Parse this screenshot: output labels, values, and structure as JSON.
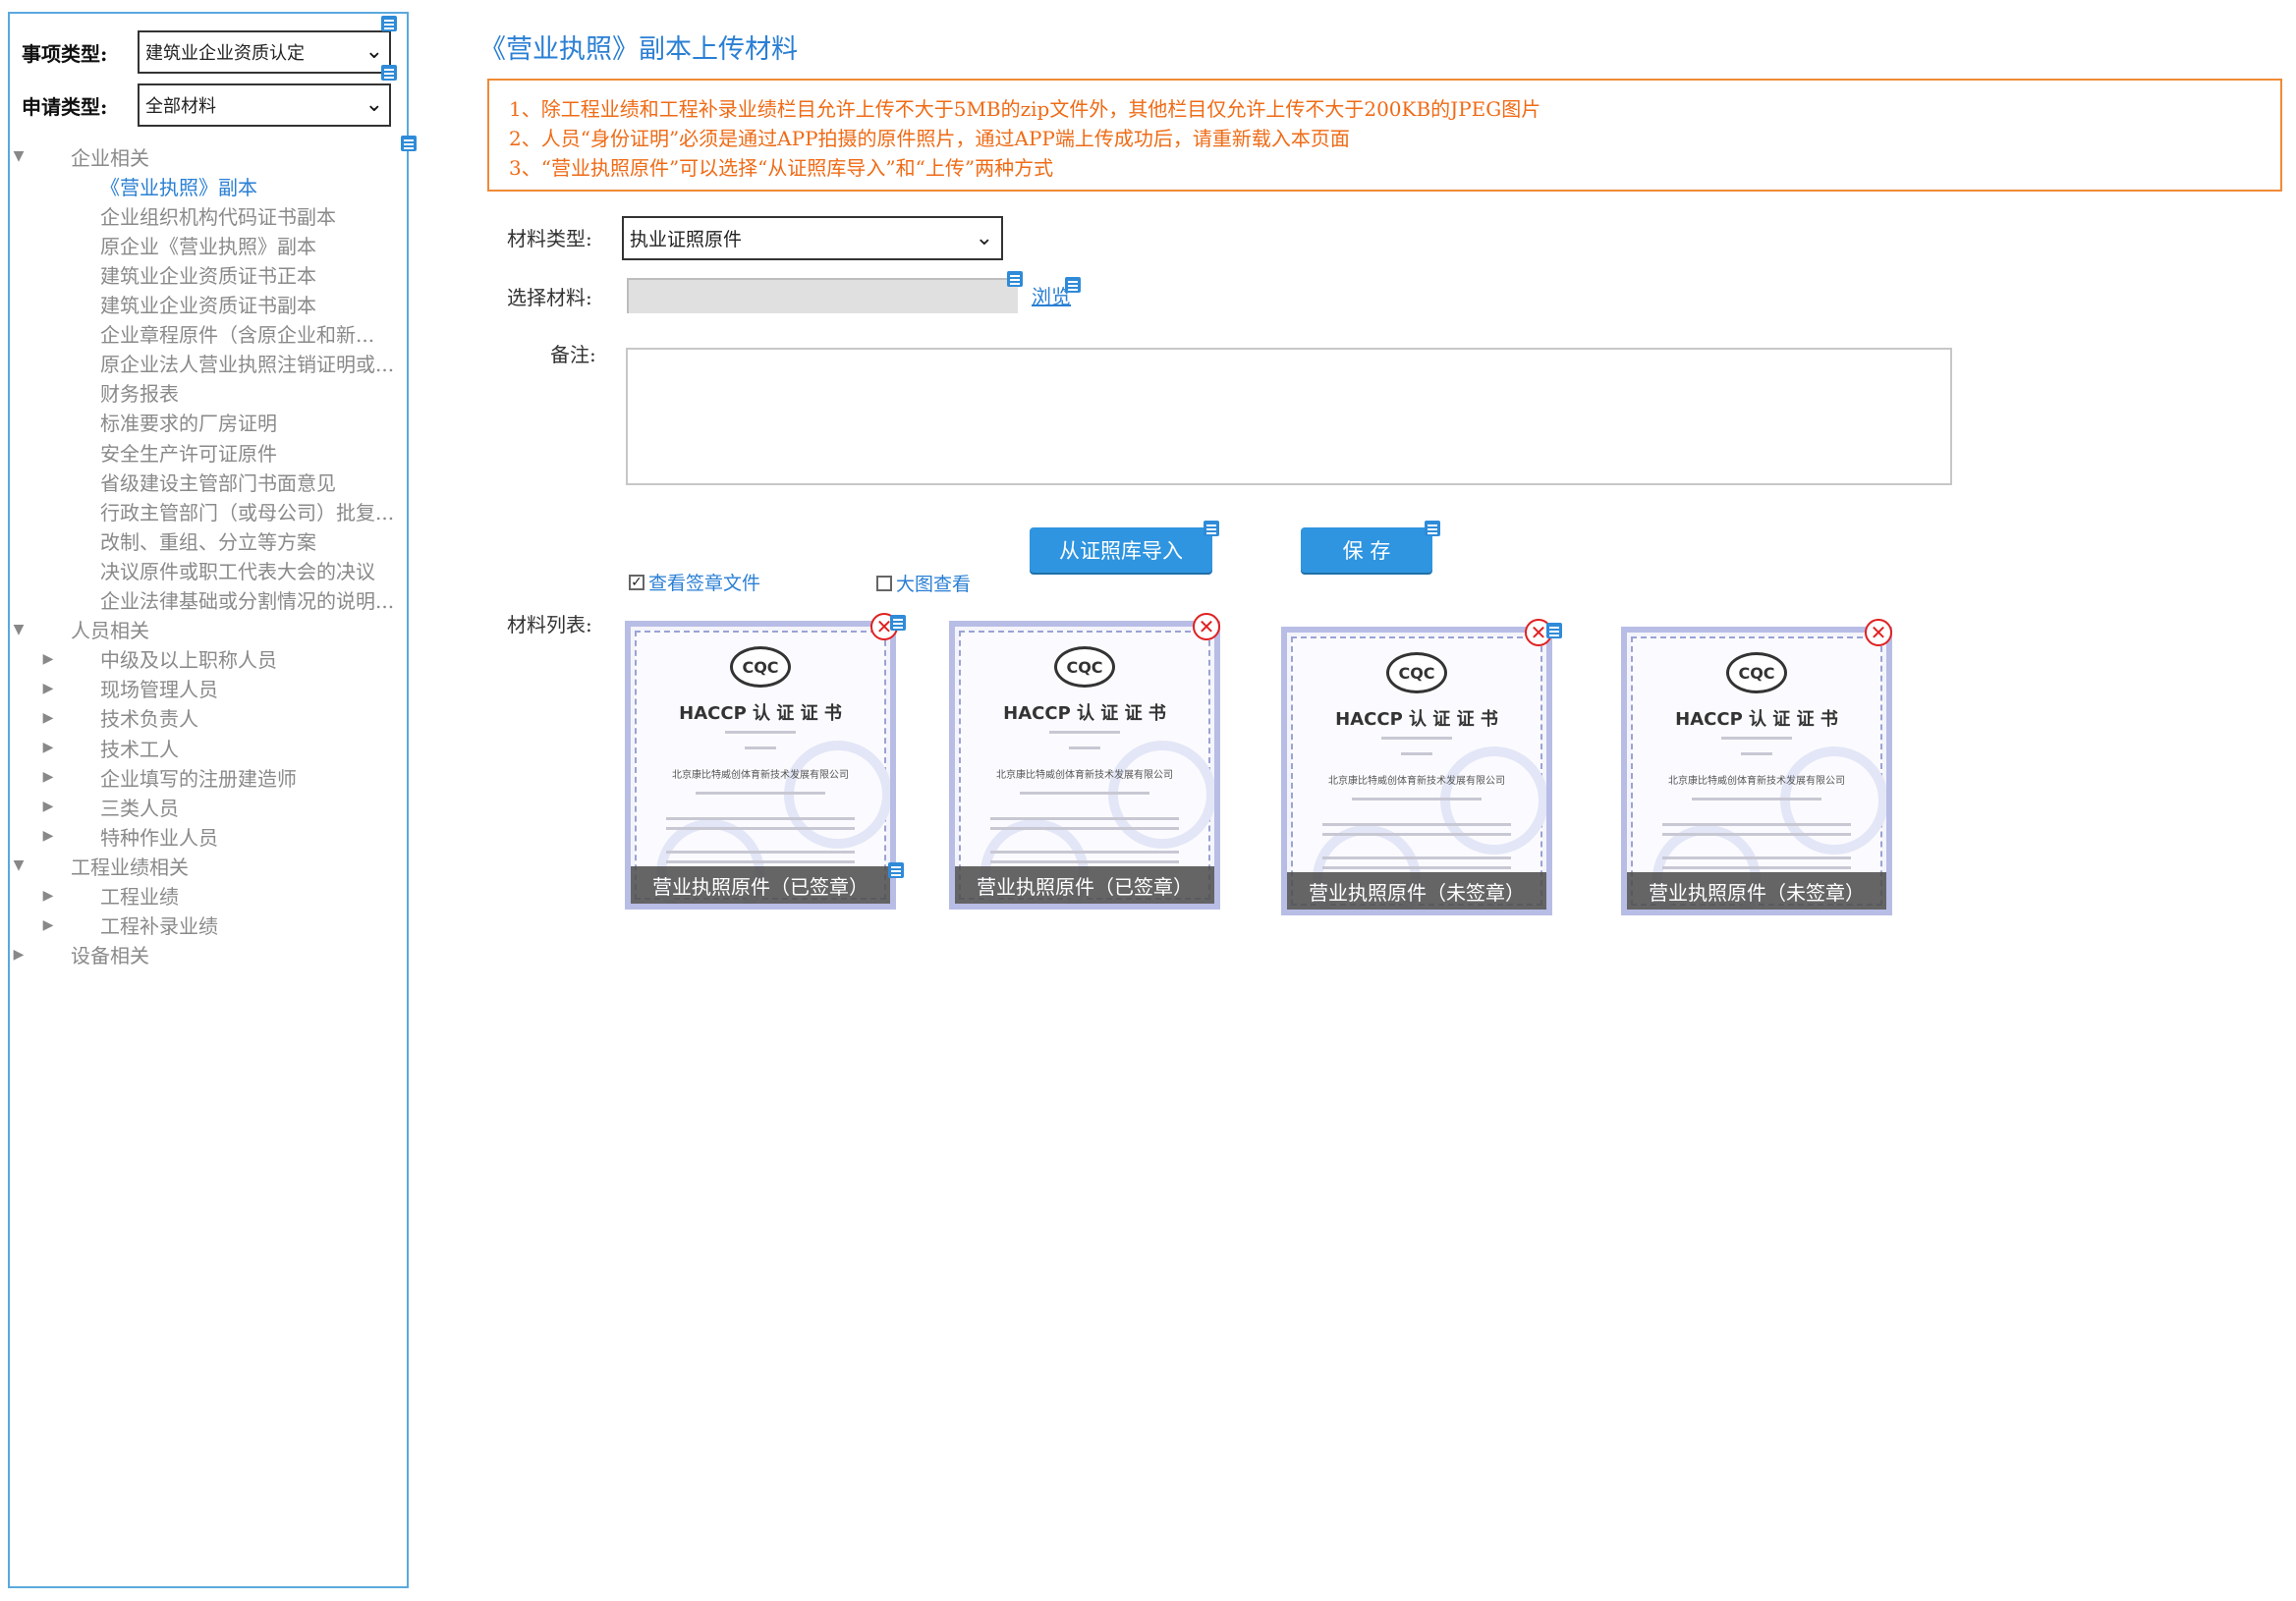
{
  "filters": {
    "matter_label": "事项类型:",
    "matter_value": "建筑业企业资质认定",
    "apply_label": "申请类型:",
    "apply_value": "全部材料"
  },
  "tree": {
    "groups": [
      {
        "label": "企业相关",
        "items": [
          "《营业执照》副本",
          "企业组织机构代码证书副本",
          "原企业《营业执照》副本",
          "建筑业企业资质证书正本",
          "建筑业企业资质证书副本",
          "企业章程原件（含原企业和新...",
          "原企业法人营业执照注销证明或...",
          "财务报表",
          "标准要求的厂房证明",
          "安全生产许可证原件",
          "省级建设主管部门书面意见",
          "行政主管部门（或母公司）批复...",
          "改制、重组、分立等方案",
          "决议原件或职工代表大会的决议",
          "企业法律基础或分割情况的说明..."
        ]
      },
      {
        "label": "人员相关",
        "items": [
          "中级及以上职称人员",
          "现场管理人员",
          "技术负责人",
          "技术工人",
          "企业填写的注册建造师",
          "三类人员",
          "特种作业人员"
        ]
      },
      {
        "label": "工程业绩相关",
        "items": [
          "工程业绩",
          "工程补录业绩"
        ]
      },
      {
        "label": "设备相关",
        "items": []
      }
    ]
  },
  "main": {
    "title": "《营业执照》副本上传材料",
    "notices": [
      "1、除工程业绩和工程补录业绩栏目允许上传不大于5MB的zip文件外，其他栏目仅允许上传不大于200KB的JPEG图片",
      "2、人员“身份证明”必须是通过APP拍摄的原件照片，通过APP端上传成功后，请重新载入本页面",
      "3、“营业执照原件”可以选择“从证照库导入”和“上传”两种方式"
    ],
    "material_type_label": "材料类型:",
    "material_type_value": "执业证照原件",
    "select_material_label": "选择材料:",
    "browse_label": "浏览",
    "remark_label": "备注:",
    "import_button": "从证照库导入",
    "save_button": "保 存",
    "view_signed_label": "查看签章文件",
    "view_signed_checked": true,
    "large_view_label": "大图查看",
    "large_view_checked": false,
    "list_label": "材料列表:",
    "thumbnails": [
      {
        "caption": "营业执照原件（已签章）",
        "cert_title": "HACCP 认 证 证 书",
        "logo": "CQC",
        "company": "北京康比特威创体育新技术发展有限公司"
      },
      {
        "caption": "营业执照原件（已签章）",
        "cert_title": "HACCP 认 证 证 书",
        "logo": "CQC",
        "company": "北京康比特威创体育新技术发展有限公司"
      },
      {
        "caption": "营业执照原件（未签章）",
        "cert_title": "HACCP 认 证 证 书",
        "logo": "CQC",
        "company": "北京康比特威创体育新技术发展有限公司"
      },
      {
        "caption": "营业执照原件（未签章）",
        "cert_title": "HACCP 认 证 证 书",
        "logo": "CQC",
        "company": "北京康比特威创体育新技术发展有限公司"
      }
    ]
  },
  "colors": {
    "accent": "#2a7fd4",
    "button": "#2f95e0",
    "notice": "#ef6b16",
    "panel_border": "#5aa9dd",
    "delete": "#e02020"
  }
}
